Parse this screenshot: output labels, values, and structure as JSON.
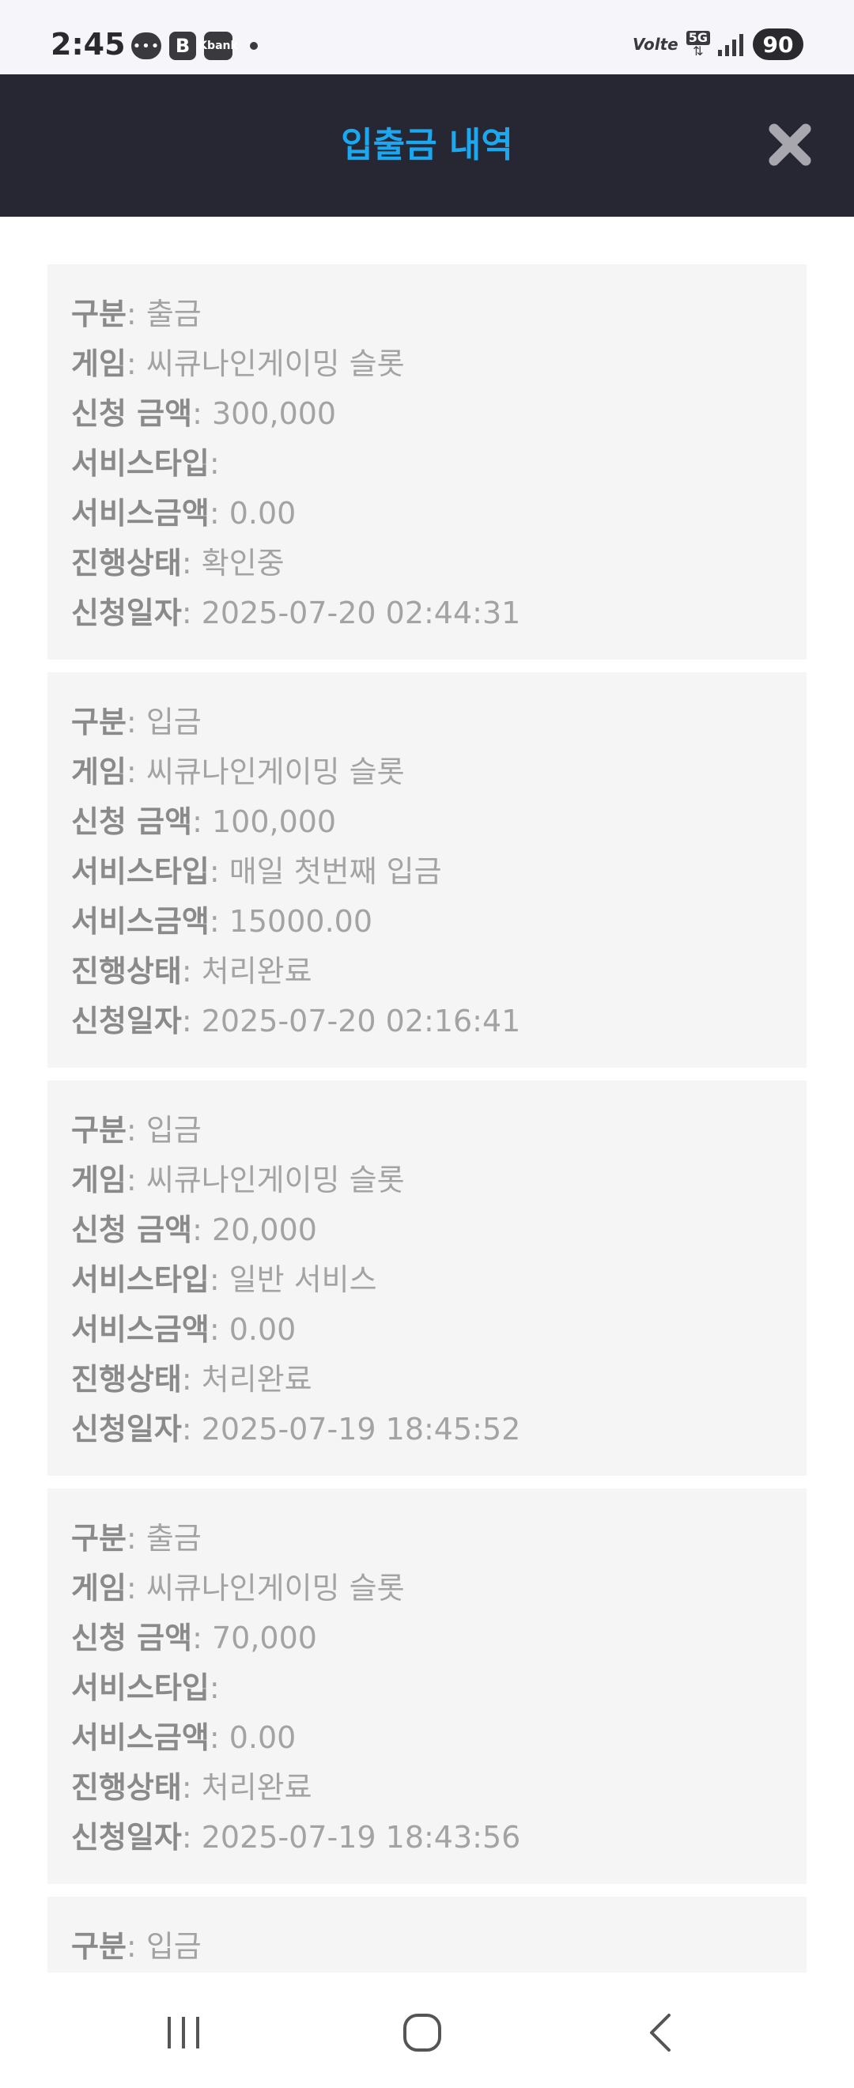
{
  "status_bar": {
    "time": "2:45",
    "left_icons": {
      "chat": "•••",
      "b_app": "B",
      "kbank": "Kbank"
    },
    "volte": "Volte",
    "network": "5G",
    "battery": "90"
  },
  "header": {
    "title": "입출금 내역",
    "close_icon": "close-icon",
    "title_color": "#1aa8f0",
    "background": "#272633"
  },
  "labels": {
    "type": "구분",
    "game": "게임",
    "amount": "신청 금액",
    "service_type": "서비스타입",
    "service_amount": "서비스금액",
    "status": "진행상태",
    "date": "신청일자"
  },
  "transactions": [
    {
      "type": "출금",
      "game": "씨큐나인게이밍 슬롯",
      "amount": "300,000",
      "service_type": "",
      "service_amount": "0.00",
      "status": "확인중",
      "date": "2025-07-20 02:44:31"
    },
    {
      "type": "입금",
      "game": "씨큐나인게이밍 슬롯",
      "amount": "100,000",
      "service_type": "매일 첫번째 입금",
      "service_amount": "15000.00",
      "status": "처리완료",
      "date": "2025-07-20 02:16:41"
    },
    {
      "type": "입금",
      "game": "씨큐나인게이밍 슬롯",
      "amount": "20,000",
      "service_type": "일반 서비스",
      "service_amount": "0.00",
      "status": "처리완료",
      "date": "2025-07-19 18:45:52"
    },
    {
      "type": "출금",
      "game": "씨큐나인게이밍 슬롯",
      "amount": "70,000",
      "service_type": "",
      "service_amount": "0.00",
      "status": "처리완료",
      "date": "2025-07-19 18:43:56"
    },
    {
      "type": "입금"
    }
  ],
  "nav": {
    "recents_icon": "recents-icon",
    "home_icon": "home-icon",
    "back_icon": "back-icon"
  }
}
